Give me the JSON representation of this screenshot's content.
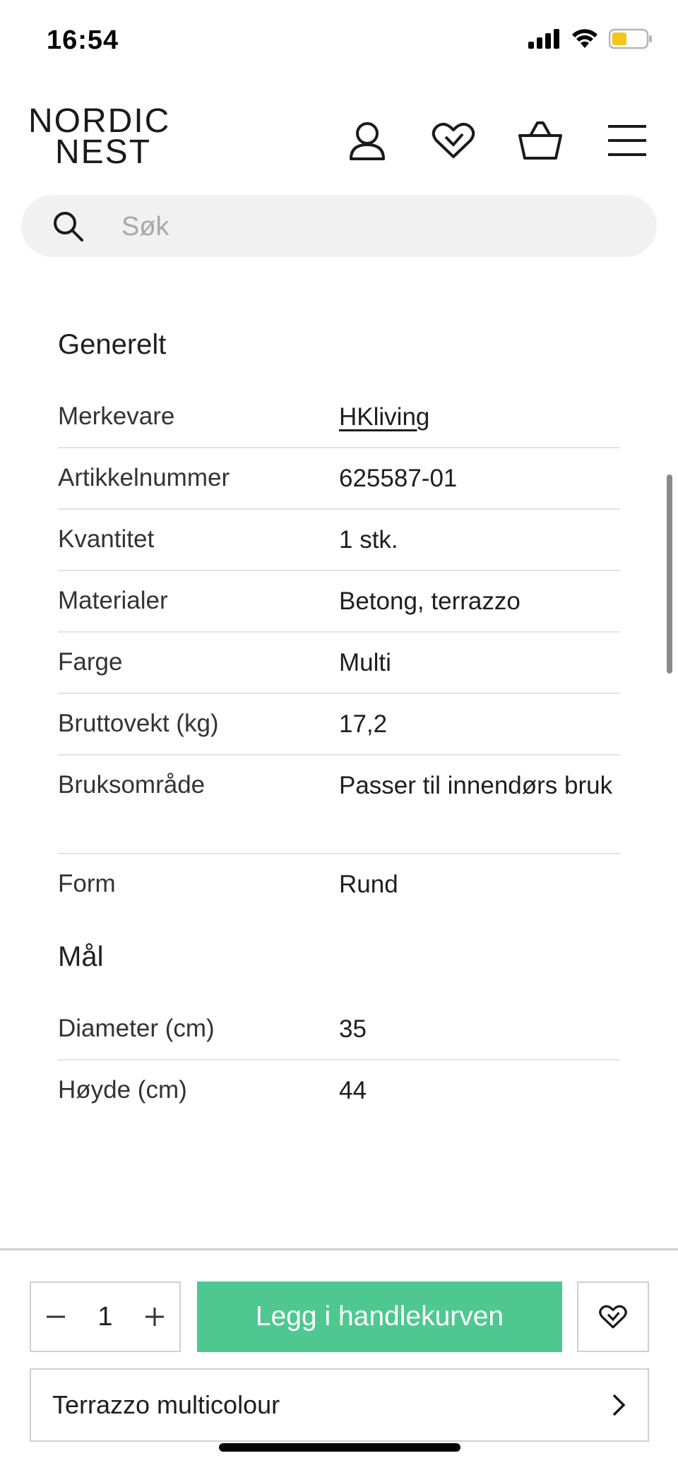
{
  "status": {
    "time": "16:54"
  },
  "header": {
    "logo_line1": "NORDIC",
    "logo_line2": "NEST"
  },
  "search": {
    "placeholder": "Søk"
  },
  "sections": {
    "general": {
      "title": "Generelt",
      "rows": [
        {
          "label": "Merkevare",
          "value": "HKliving"
        },
        {
          "label": "Artikkelnummer",
          "value": "625587-01"
        },
        {
          "label": "Kvantitet",
          "value": "1 stk."
        },
        {
          "label": "Materialer",
          "value": "Betong, terrazzo"
        },
        {
          "label": "Farge",
          "value": "Multi"
        },
        {
          "label": "Bruttovekt (kg)",
          "value": "17,2"
        },
        {
          "label": "Bruksområde",
          "value": "Passer til innendørs bruk"
        },
        {
          "label": "Form",
          "value": "Rund"
        }
      ]
    },
    "dimensions": {
      "title": "Mål",
      "rows": [
        {
          "label": "Diameter (cm)",
          "value": "35"
        },
        {
          "label": "Høyde (cm)",
          "value": "44"
        }
      ]
    }
  },
  "purchase": {
    "quantity": "1",
    "add_to_cart_label": "Legg i handlekurven",
    "variant_label": "Terrazzo multicolour"
  },
  "colors": {
    "accent_green": "#4ec890",
    "battery_yellow": "#f5c518"
  },
  "icons": [
    "user-icon",
    "heart-icon",
    "basket-icon",
    "menu-icon",
    "search-icon",
    "minus-icon",
    "plus-icon",
    "chevron-right-icon"
  ]
}
